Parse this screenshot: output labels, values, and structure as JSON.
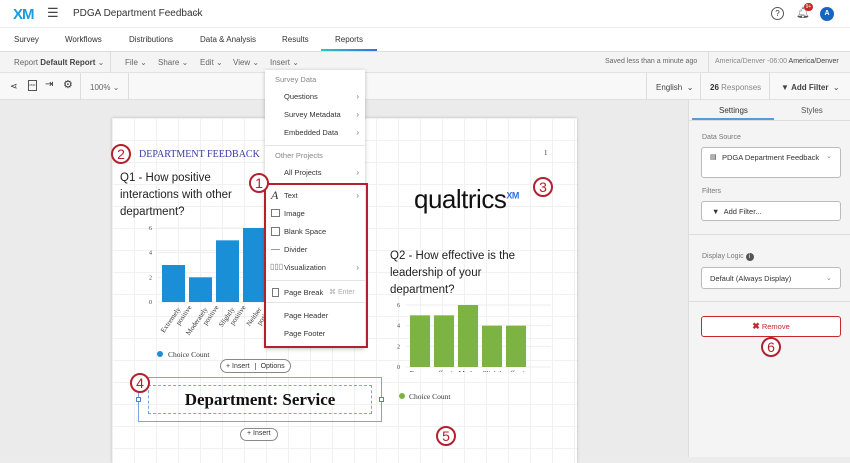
{
  "header": {
    "logo": "XM",
    "title": "PDGA Department Feedback",
    "notif_badge": "9+",
    "avatar": "A"
  },
  "tabs": [
    "Survey",
    "Workflows",
    "Distributions",
    "Data & Analysis",
    "Results",
    "Reports"
  ],
  "toolbar": {
    "report_label": "Report",
    "report_name": "Default Report",
    "menus": [
      "File",
      "Share",
      "Edit",
      "View",
      "Insert"
    ],
    "saved": "Saved less than a minute ago",
    "tz_label": "America/Denver -06:00",
    "tz_value": "America/Denver"
  },
  "toolbar2": {
    "zoom": "100%",
    "language": "English",
    "responses_count": "26",
    "responses_label": "Responses",
    "add_filter": "Add Filter"
  },
  "insert_menu": {
    "survey_data_header": "Survey Data",
    "survey_items": [
      "Questions",
      "Survey Metadata",
      "Embedded Data"
    ],
    "other_header": "Other Projects",
    "other_items": [
      "All Projects"
    ],
    "items": [
      {
        "label": "Text"
      },
      {
        "label": "Image"
      },
      {
        "label": "Blank Space"
      },
      {
        "label": "Divider"
      },
      {
        "label": "Visualization"
      },
      {
        "label": "Page Break",
        "shortcut": "⌘ Enter"
      },
      {
        "label": "Page Header"
      },
      {
        "label": "Page Footer"
      }
    ]
  },
  "report": {
    "header_text": "DEPARTMENT FEEDBACK",
    "page_number": "1",
    "logo_text": "qualtrics",
    "logo_sup": "XM",
    "q1_title": "Q1 - How positive interactions with other department?",
    "q2_title": "Q2 - How effective is the leadership of your department?",
    "legend": "Choice Count",
    "insert": "Insert",
    "options": "Options",
    "section_title": "Department: Service"
  },
  "panel": {
    "tabs": [
      "Settings",
      "Styles"
    ],
    "data_source_label": "Data Source",
    "data_source": "PDGA Department Feedback",
    "filters_label": "Filters",
    "add_filter": "Add Filter...",
    "display_logic_label": "Display Logic",
    "display_logic": "Default (Always Display)",
    "remove": "Remove"
  },
  "callouts": [
    "1",
    "2",
    "3",
    "4",
    "5",
    "6"
  ],
  "chart_data": [
    {
      "type": "bar",
      "title": "Q1 - How positive interactions with other department?",
      "categories": [
        "Extremely positive",
        "Moderately positive",
        "Slightly positive",
        "Neither positive"
      ],
      "values": [
        3,
        2,
        5,
        6
      ],
      "ylim": [
        0,
        6
      ],
      "yticks": [
        "0",
        "2",
        "4",
        "6"
      ],
      "legend": "Choice Count",
      "color": "#1a8fd8"
    },
    {
      "type": "bar",
      "title": "Q2 - How effective is the leadership of your department?",
      "categories": [
        "Extrem",
        "effecti",
        "Moder",
        "Slightl",
        "effecti"
      ],
      "values": [
        5,
        5,
        6,
        4,
        4
      ],
      "ylim": [
        0,
        6
      ],
      "yticks": [
        "0",
        "2",
        "4",
        "6"
      ],
      "legend": "Choice Count",
      "color": "#7cb342"
    }
  ]
}
